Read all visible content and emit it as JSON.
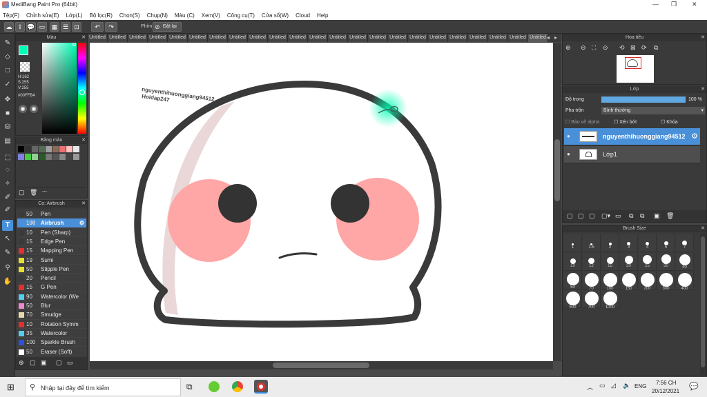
{
  "window": {
    "title": "MediBang Paint Pro (64bit)"
  },
  "menu": [
    "Tệp(F)",
    "Chỉnh sửa(E)",
    "Lớp(L)",
    "Bộ lọc(R)",
    "Chọn(S)",
    "Chụp(N)",
    "Màu (C)",
    "Xem(V)",
    "Công cụ(T)",
    "Cửa sổ(W)",
    "Cloud",
    "Help"
  ],
  "toolbar": {
    "phim_label": "Phím",
    "reset_label": "Đặt lại"
  },
  "color_panel": {
    "title": "Màu",
    "h": "H:162",
    "s": "S:255",
    "v": "V:255",
    "hex": "#00FFB4",
    "fg_color": "#00FFB4"
  },
  "palette_panel": {
    "title": "Bảng màu",
    "footer": "---"
  },
  "brush_panel": {
    "title": "Cọ: Airbrush",
    "items": [
      {
        "size": "50",
        "name": "Pen",
        "color": "#3a3a3a"
      },
      {
        "size": "100",
        "name": "Airbrush",
        "color": "#4a90d9"
      },
      {
        "size": "10",
        "name": "Pen (Sharp)",
        "color": "#3a3a3a"
      },
      {
        "size": "15",
        "name": "Edge Pen",
        "color": "#3a3a3a"
      },
      {
        "size": "15",
        "name": "Mapping Pen",
        "color": "#e03030"
      },
      {
        "size": "19",
        "name": "Sumi",
        "color": "#e8e030"
      },
      {
        "size": "50",
        "name": "Stipple Pen",
        "color": "#e8e030"
      },
      {
        "size": "20",
        "name": "Pencil",
        "color": "#3a3a3a"
      },
      {
        "size": "15",
        "name": "G Pen",
        "color": "#e03030"
      },
      {
        "size": "90",
        "name": "Watercolor (We",
        "color": "#55ccee"
      },
      {
        "size": "50",
        "name": "Blur",
        "color": "#ee88cc"
      },
      {
        "size": "70",
        "name": "Smudge",
        "color": "#e8d8b0"
      },
      {
        "size": "10",
        "name": "Rotation Symm",
        "color": "#e03030"
      },
      {
        "size": "35",
        "name": "Watercolor",
        "color": "#55ccee"
      },
      {
        "size": "100",
        "name": "Sparkle Brush",
        "color": "#3050e0"
      },
      {
        "size": "50",
        "name": "Eraser (Soft)",
        "color": "#ffffff"
      }
    ]
  },
  "tabs": [
    "Untitled",
    "Untitled",
    "Untitled",
    "Untitled",
    "Untitled",
    "Untitled",
    "Untitled",
    "Untitled",
    "Untitled",
    "Untitled",
    "Untitled",
    "Untitled",
    "Untitled",
    "Untitled",
    "Untitled",
    "Untitled",
    "Untitled",
    "Untitled",
    "Untitled",
    "Untitled",
    "Untitled",
    "Untitled",
    "Untitled"
  ],
  "canvas": {
    "watermark_line1": "nguyenthihuonggiang94512",
    "watermark_line2": "Hoidap247"
  },
  "navigator": {
    "title": "Hoa tiêu"
  },
  "layer_panel": {
    "title": "Lớp",
    "opacity_label": "Độ trong",
    "opacity_value": "100 %",
    "opacity_fraction": 1.0,
    "blend_label": "Pha trộn",
    "blend_value": "Bình thường",
    "protect_alpha": "Bảo vệ alpha",
    "clipping": "Xén bớt",
    "lock": "Khóa",
    "layers": [
      {
        "name": "nguyenthihuonggiang94512"
      },
      {
        "name": "Lớp1"
      }
    ]
  },
  "brush_size_panel": {
    "title": "Brush Size",
    "sizes": [
      "1",
      "1.5",
      "2",
      "3",
      "4",
      "5",
      "7",
      "10",
      "12",
      "15",
      "20",
      "25",
      "30",
      "40",
      "50",
      "70",
      "100",
      "150",
      "200",
      "300",
      "400",
      "500",
      "700",
      "1000"
    ]
  },
  "taskbar": {
    "search_placeholder": "Nhập tại đây để tìm kiếm",
    "time": "7:56 CH",
    "date": "20/12/2021",
    "lang": "ENG"
  }
}
